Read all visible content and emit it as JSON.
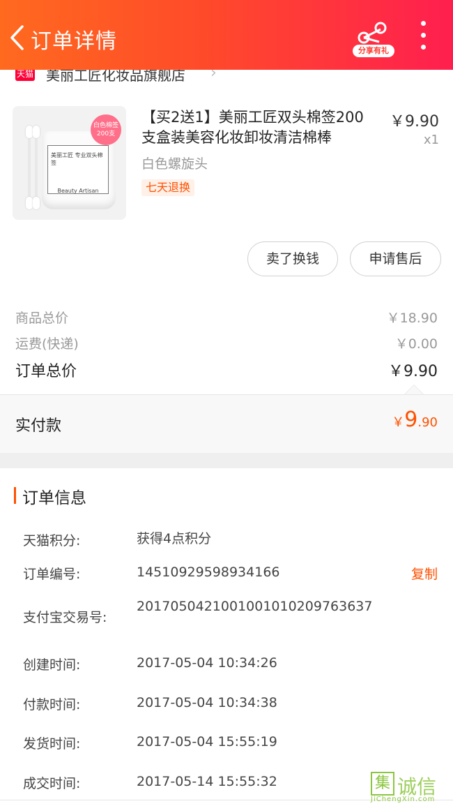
{
  "header": {
    "title": "订单详情",
    "share_label": "分享有礼",
    "colors": {
      "gradient_start": "#ff6a1f",
      "gradient_end": "#ff1f4f"
    }
  },
  "shop": {
    "badge": "天猫",
    "name": "美丽工匠化妆品旗舰店"
  },
  "product": {
    "title": "【买2送1】美丽工匠双头棉签200支盒装美容化妆卸妆清洁棉棒",
    "sku": "白色螺旋头",
    "tag": "七天退换",
    "price": "￥9.90",
    "quantity": "x1",
    "image_badge": "白色棉签 200支",
    "image_label": "美丽工匠 专业双头棉签",
    "image_brand": "Beauty Artisan"
  },
  "actions": {
    "sell_label": "卖了换钱",
    "after_sale_label": "申请售后"
  },
  "summary": {
    "goods_total_label": "商品总价",
    "goods_total_value": "￥18.90",
    "shipping_label": "运费(快递)",
    "shipping_value": "￥0.00",
    "order_total_label": "订单总价",
    "order_total_value": "￥9.90",
    "paid_label": "实付款",
    "paid_currency": "￥",
    "paid_integer": "9",
    "paid_decimal": ".90"
  },
  "order_info": {
    "title": "订单信息",
    "copy_label": "复制",
    "rows": [
      {
        "label": "天猫积分:",
        "value": "获得4点积分"
      },
      {
        "label": "订单编号:",
        "value": "14510929598934166"
      },
      {
        "label": "支付宝交易号:",
        "value": "2017050421001001010209763637"
      },
      {
        "label": "创建时间:",
        "value": "2017-05-04 10:34:26"
      },
      {
        "label": "付款时间:",
        "value": "2017-05-04 10:34:38"
      },
      {
        "label": "发货时间:",
        "value": "2017-05-04 15:55:19"
      },
      {
        "label": "成交时间:",
        "value": "2017-05-14 15:55:32"
      }
    ]
  },
  "watermark": {
    "logo_char": "集",
    "text": "诚信",
    "site": "JiChengXin.com"
  },
  "colors": {
    "accent": "#ff5000",
    "tmall_red": "#ff0036"
  }
}
